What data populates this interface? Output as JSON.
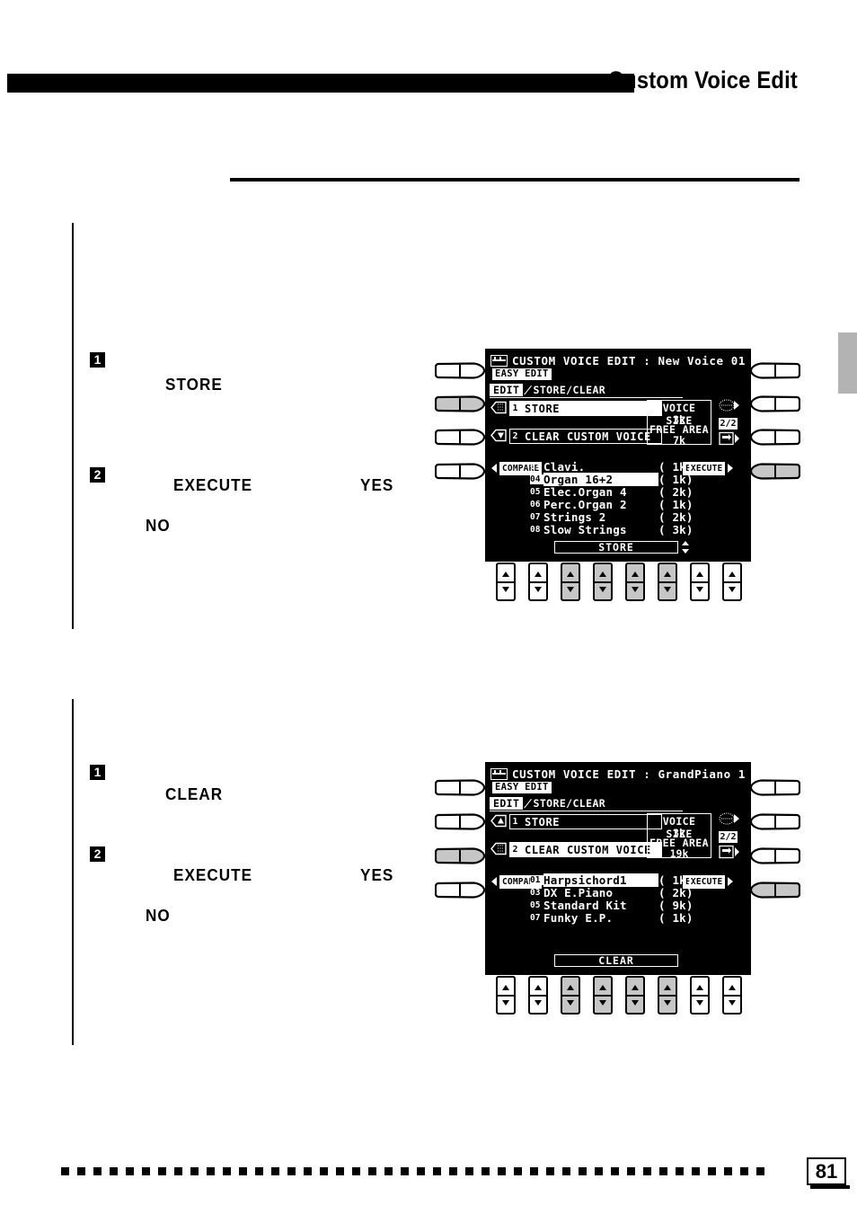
{
  "page": {
    "header_title": "Custom Voice Edit",
    "page_number": "81"
  },
  "sections": [
    {
      "id": "store",
      "steps": [
        {
          "badge": "1",
          "keywords": [
            "STORE"
          ]
        },
        {
          "badge": "2",
          "keywords": [
            "EXECUTE",
            "YES",
            "NO"
          ]
        }
      ],
      "lcd": {
        "title": "CUSTOM VOICE EDIT : New Voice 01",
        "easy_edit_tab": "EASY EDIT",
        "edit_tab": "EDIT",
        "mode_label": "STORE/CLEAR",
        "rows": [
          {
            "num": "1",
            "label": "STORE",
            "selected": true,
            "icon": "mesh-arrow-left-icon"
          },
          {
            "num": "2",
            "label": "CLEAR CUSTOM VOICE",
            "selected": false,
            "icon": "triangle-down-icon"
          }
        ],
        "info": {
          "voice_size_label": "VOICE SIZE",
          "voice_size_value": "3k",
          "free_area_label": "FREE AREA",
          "free_area_value": "7k"
        },
        "page_indicator": "2/2",
        "compare_label": "COMPARE",
        "execute_label": "EXECUTE",
        "voices": [
          {
            "num": "03",
            "name": "Clavi.",
            "size": "(  1k)",
            "selected": false
          },
          {
            "num": "04",
            "name": "Organ 16+2",
            "size": "(  1k)",
            "selected": true
          },
          {
            "num": "05",
            "name": "Elec.Organ 4",
            "size": "(  2k)",
            "selected": false
          },
          {
            "num": "06",
            "name": "Perc.Organ 2",
            "size": "(  1k)",
            "selected": false
          },
          {
            "num": "07",
            "name": "Strings 2",
            "size": "(  2k)",
            "selected": false
          },
          {
            "num": "08",
            "name": "Slow Strings",
            "size": "(  3k)",
            "selected": false
          }
        ],
        "bottom_bar": "STORE"
      },
      "left_buttons": [
        false,
        true,
        false,
        false
      ],
      "right_buttons": [
        false,
        false,
        false,
        true
      ],
      "steppers": [
        false,
        false,
        true,
        true,
        true,
        true,
        false,
        false
      ]
    },
    {
      "id": "clear",
      "steps": [
        {
          "badge": "1",
          "keywords": [
            "CLEAR"
          ]
        },
        {
          "badge": "2",
          "keywords": [
            "EXECUTE",
            "YES",
            "NO"
          ]
        }
      ],
      "lcd": {
        "title": "CUSTOM VOICE EDIT : GrandPiano 1",
        "easy_edit_tab": "EASY EDIT",
        "edit_tab": "EDIT",
        "mode_label": "STORE/CLEAR",
        "rows": [
          {
            "num": "1",
            "label": "STORE",
            "selected": false,
            "icon": "triangle-up-icon"
          },
          {
            "num": "2",
            "label": "CLEAR CUSTOM VOICE",
            "selected": true,
            "icon": "mesh-arrow-left-icon"
          }
        ],
        "info": {
          "voice_size_label": "VOICE SIZE",
          "voice_size_value": "3k",
          "free_area_label": "FREE AREA",
          "free_area_value": "19k"
        },
        "page_indicator": "2/2",
        "compare_label": "COMPARE",
        "execute_label": "EXECUTE",
        "voices": [
          {
            "num": "01",
            "name": "Harpsichord1",
            "size": "(  1k)",
            "selected": true
          },
          {
            "num": "03",
            "name": "DX E.Piano",
            "size": "(  2k)",
            "selected": false
          },
          {
            "num": "05",
            "name": "Standard Kit",
            "size": "(  9k)",
            "selected": false
          },
          {
            "num": "07",
            "name": "Funky E.P.",
            "size": "(  1k)",
            "selected": false
          }
        ],
        "bottom_bar": "CLEAR"
      },
      "left_buttons": [
        false,
        false,
        true,
        false
      ],
      "right_buttons": [
        false,
        false,
        false,
        true
      ],
      "steppers": [
        false,
        false,
        true,
        true,
        true,
        true,
        false,
        false
      ]
    }
  ]
}
